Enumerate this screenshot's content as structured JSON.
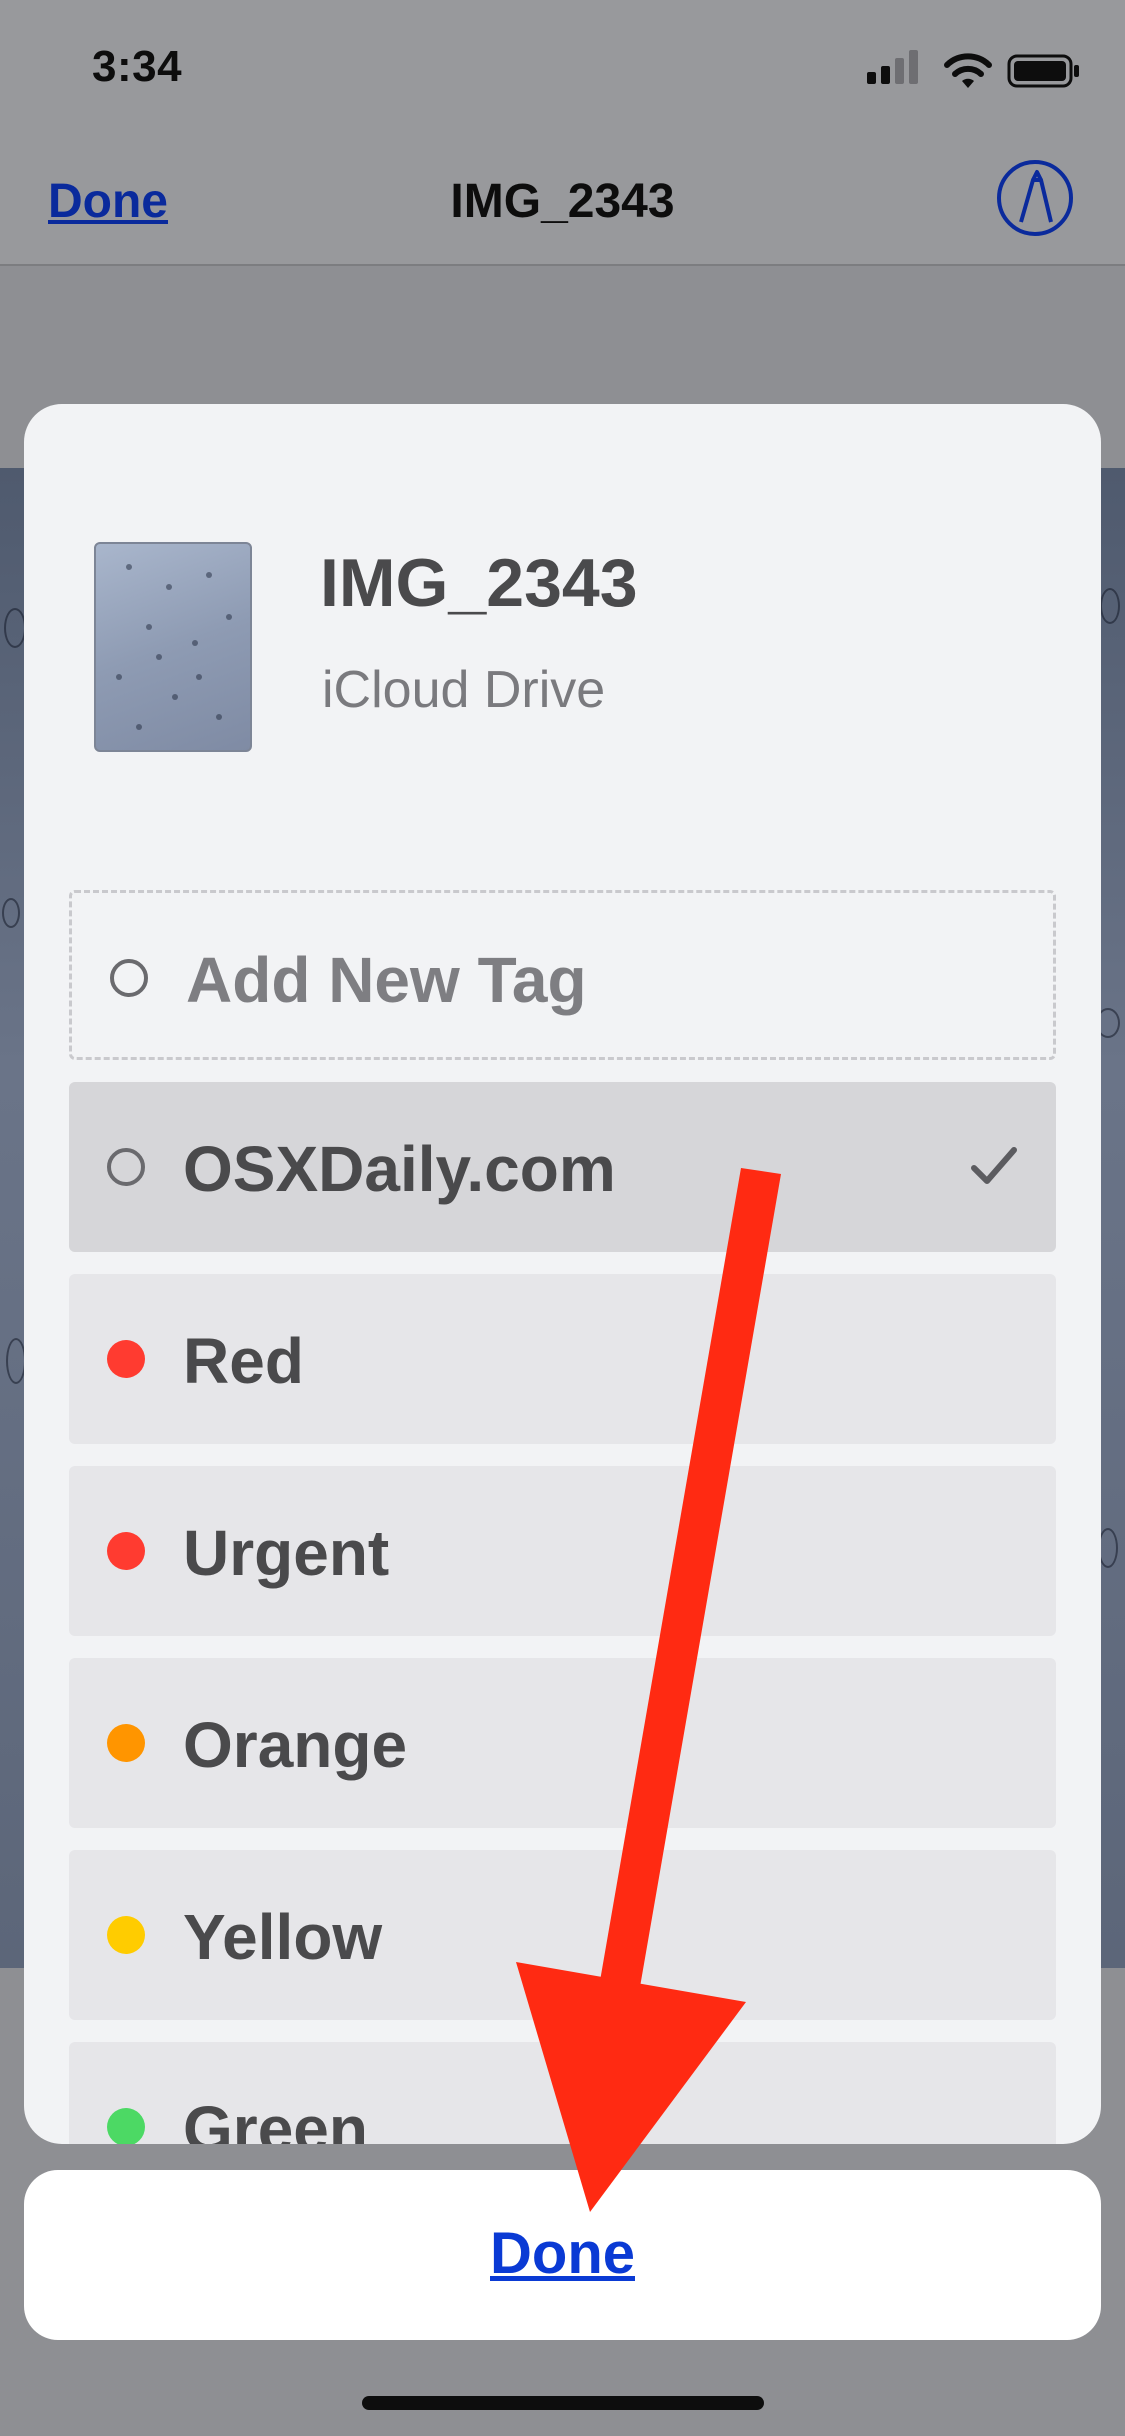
{
  "status_bar": {
    "time": "3:34"
  },
  "nav": {
    "done_label": "Done",
    "title": "IMG_2343",
    "markup_icon": "markup-icon"
  },
  "sheet": {
    "file_name": "IMG_2343",
    "location": "iCloud Drive",
    "tags": [
      {
        "label": "Add New Tag",
        "type": "add",
        "color": ""
      },
      {
        "label": "OSXDaily.com",
        "type": "selected",
        "color": "",
        "checked": true
      },
      {
        "label": "Red",
        "type": "color",
        "color": "#ff3b30"
      },
      {
        "label": "Urgent",
        "type": "color",
        "color": "#ff3b30"
      },
      {
        "label": "Orange",
        "type": "color",
        "color": "#ff9500"
      },
      {
        "label": "Yellow",
        "type": "color",
        "color": "#ffcc00"
      },
      {
        "label": "Green",
        "type": "color",
        "color": "#4cd964"
      }
    ]
  },
  "done_button": {
    "label": "Done"
  },
  "colors": {
    "accent": "#0a3ad4",
    "annotation_arrow": "#ff2a12"
  }
}
